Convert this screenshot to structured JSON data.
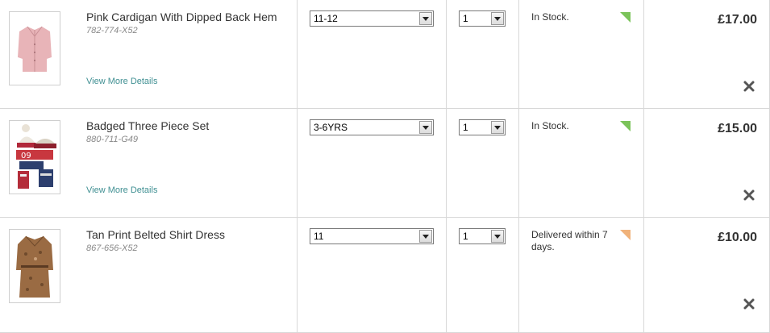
{
  "basket": {
    "items": [
      {
        "title": "Pink Cardigan With Dipped Back Hem",
        "code": "782-774-X52",
        "details_label": "View More Details",
        "size": "11-12",
        "qty": "1",
        "stock": "In Stock.",
        "stock_status_color": "#7bc35a",
        "price": "£17.00",
        "thumbnail_icon": "pink-cardigan-image"
      },
      {
        "title": "Badged Three Piece Set",
        "code": "880-711-G49",
        "details_label": "View More Details",
        "size": "3-6YRS",
        "qty": "1",
        "stock": "In Stock.",
        "stock_status_color": "#7bc35a",
        "price": "£15.00",
        "thumbnail_icon": "hat-scarf-gloves-image"
      },
      {
        "title": "Tan Print Belted Shirt Dress",
        "code": "867-656-X52",
        "details_label": "",
        "size": "11",
        "qty": "1",
        "stock": "Delivered within 7 days.",
        "stock_status_color": "#f0b27a",
        "price": "£10.00",
        "thumbnail_icon": "tan-dress-image"
      }
    ],
    "remove_icon": "close-icon",
    "dropdown_icon": "chevron-down-icon",
    "link_color": "#3f8f92"
  }
}
